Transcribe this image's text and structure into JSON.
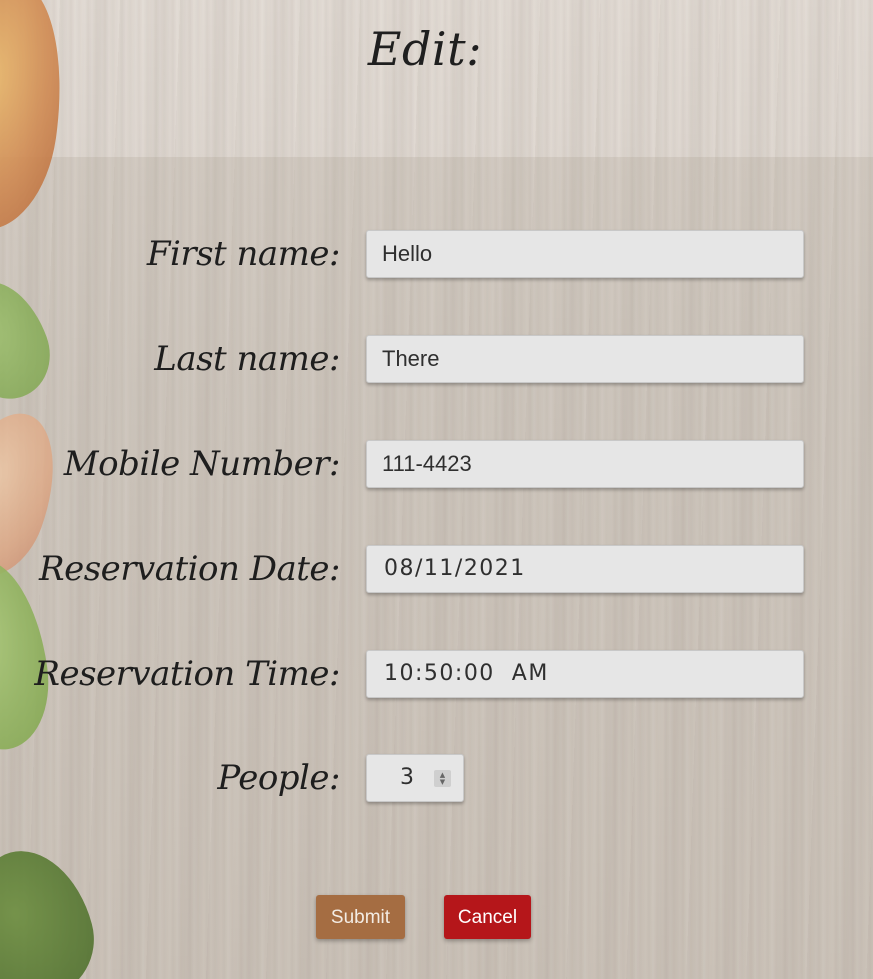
{
  "page": {
    "title": "Edit:"
  },
  "form": {
    "first_name": {
      "label": "First name:",
      "value": "Hello"
    },
    "last_name": {
      "label": "Last name:",
      "value": "There"
    },
    "mobile_number": {
      "label": "Mobile Number:",
      "value": "111-4423"
    },
    "reservation_date": {
      "label": "Reservation Date:",
      "value": "08/11/2021"
    },
    "reservation_time": {
      "label": "Reservation Time:",
      "value": "10:50:00  AM"
    },
    "people": {
      "label": "People:",
      "value": "3"
    }
  },
  "buttons": {
    "submit_label": "Submit",
    "cancel_label": "Cancel"
  },
  "colors": {
    "submit": "#a56d42",
    "cancel": "#b5161a",
    "field_bg": "#e6e6e6"
  },
  "icons": {
    "spinner": "updown-spinner-icon"
  }
}
